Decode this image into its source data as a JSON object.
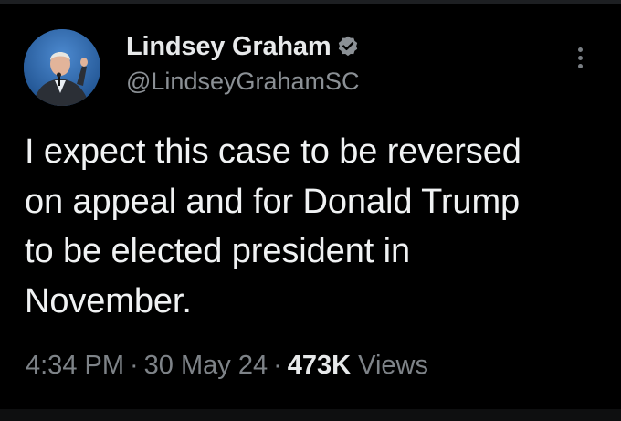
{
  "author": {
    "display_name": "Lindsey Graham",
    "handle": "@LindseyGrahamSC",
    "verified": true,
    "avatar": "profile-photo"
  },
  "tweet": {
    "lines": [
      "I expect this case to be reversed",
      "on appeal and for Donald Trump",
      "to be elected president in",
      "November."
    ]
  },
  "meta": {
    "time": "4:34 PM",
    "separator": "·",
    "date": "30 May 24",
    "views_count": "473K",
    "views_label": "Views"
  },
  "colors": {
    "background": "#000000",
    "text": "#e7e9ea",
    "muted": "#8b9095",
    "verified_badge": "#8b9095"
  },
  "icons": {
    "more": "more-vertical-icon",
    "verified": "verified-badge-icon"
  }
}
